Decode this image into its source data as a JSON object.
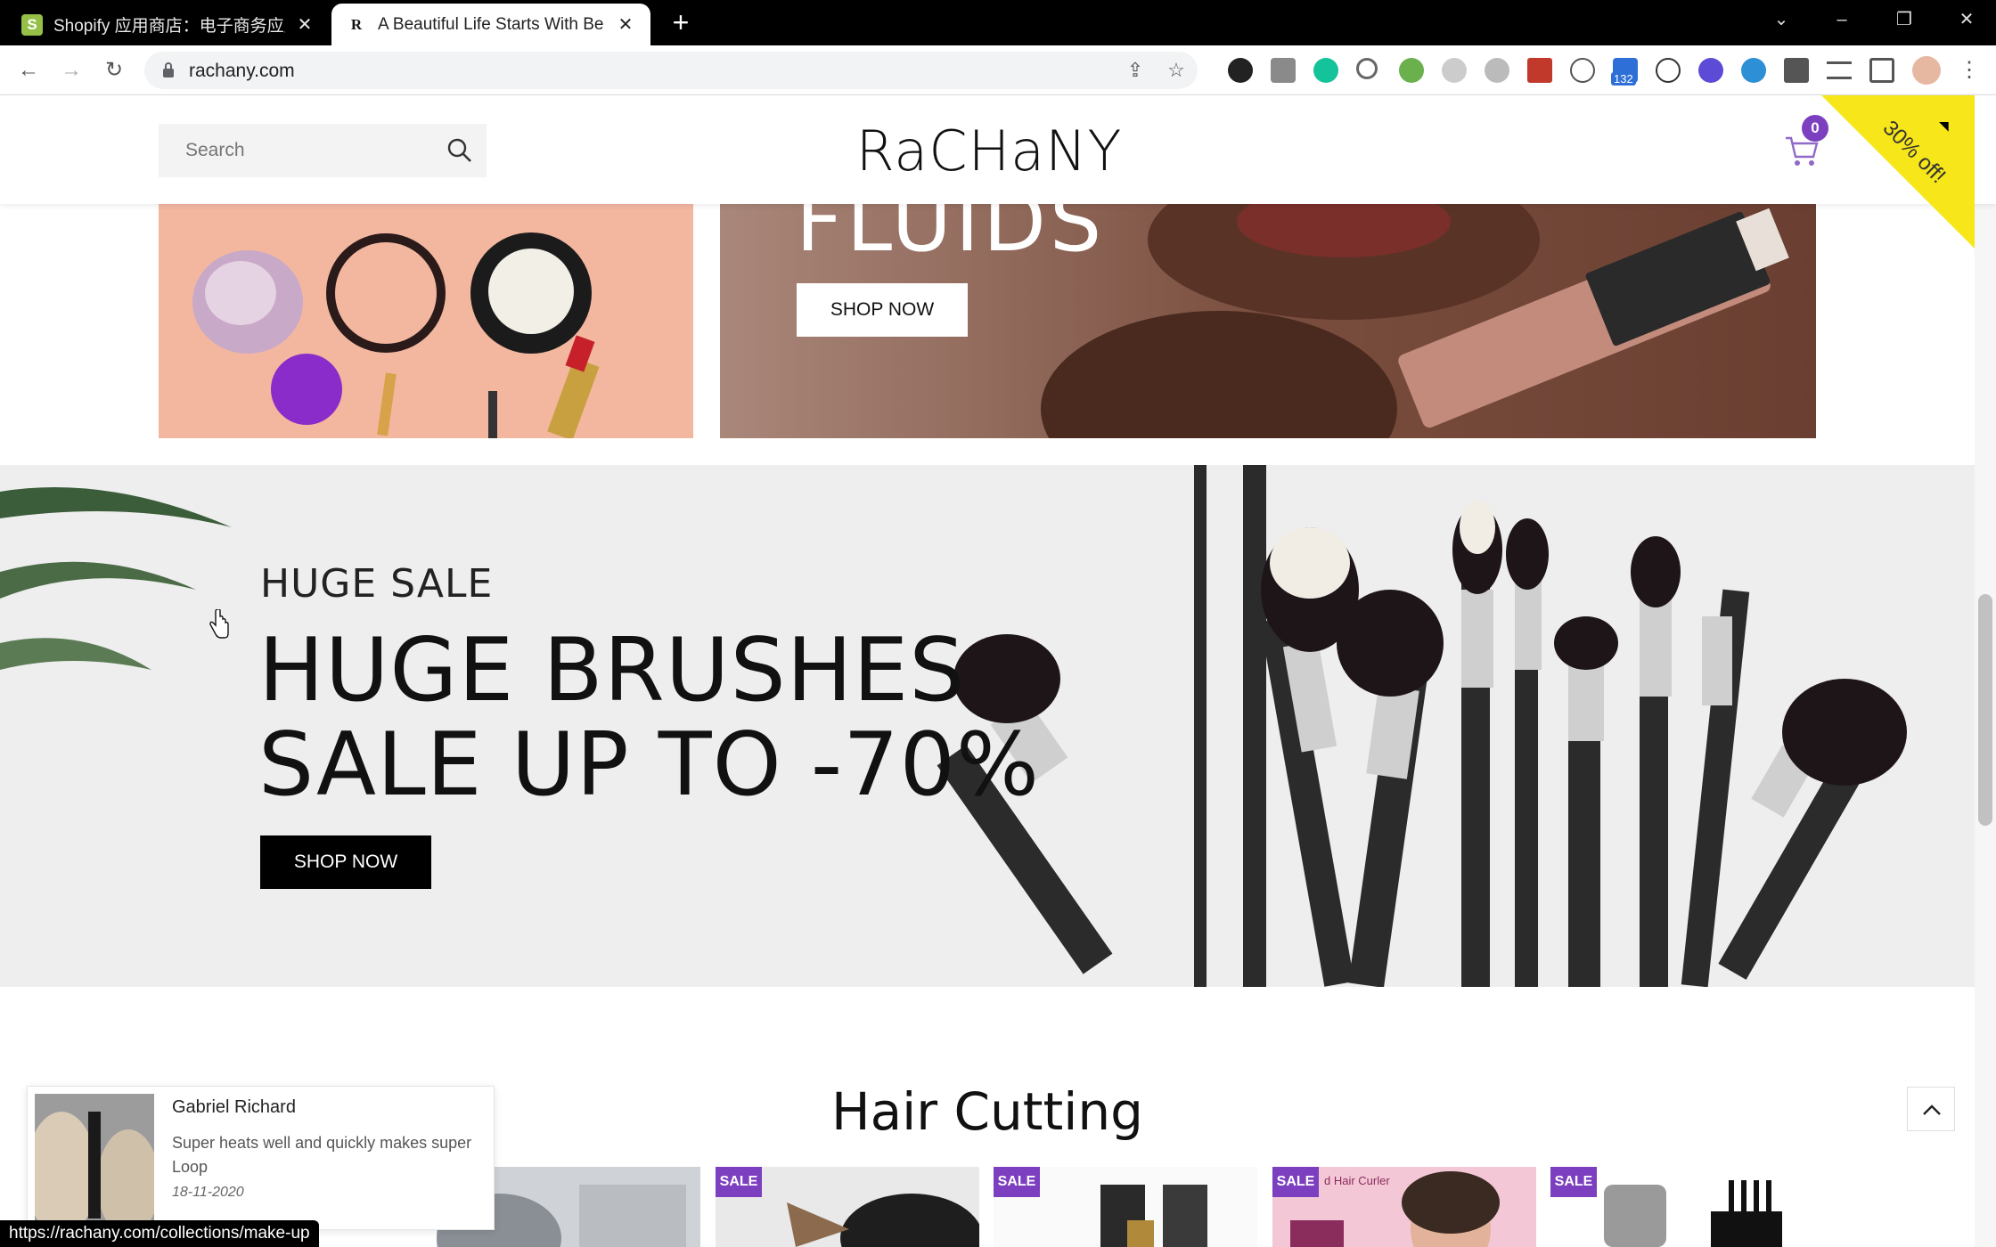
{
  "browser": {
    "tabs": [
      {
        "title": "Shopify 应用商店：电子商务应用",
        "active": false,
        "icon": "shopify-icon"
      },
      {
        "title": "A Beautiful Life Starts With Be",
        "active": true,
        "icon": "rachany-favicon"
      }
    ],
    "url": "rachany.com",
    "extensions_badge": "132",
    "status_url": "https://rachany.com/collections/make-up"
  },
  "header": {
    "search_placeholder": "Search",
    "logo": "RaCHaNY",
    "cart_count": "0",
    "promo_corner": "30% off!"
  },
  "banners": {
    "fluids_text": "FLUIDS",
    "fluids_button": "SHOP NOW"
  },
  "hero": {
    "kicker": "HUGE SALE",
    "title_line1": "HUGE BRUSHES",
    "title_line2": "SALE UP TO -70%",
    "button": "SHOP NOW"
  },
  "section": {
    "title": "Hair Cutting",
    "products": [
      {
        "sale_label": ""
      },
      {
        "sale_label": "SALE"
      },
      {
        "sale_label": "SALE"
      },
      {
        "sale_label": "SALE"
      },
      {
        "sale_label": "SALE"
      }
    ],
    "product3_caption": "d Hair Curler"
  },
  "review_popup": {
    "name": "Gabriel Richard",
    "message": "Super heats well and quickly makes super Loop",
    "date": "18-11-2020"
  },
  "colors": {
    "accent_purple": "#7b3fbf",
    "corner_yellow": "#f6e61a"
  }
}
